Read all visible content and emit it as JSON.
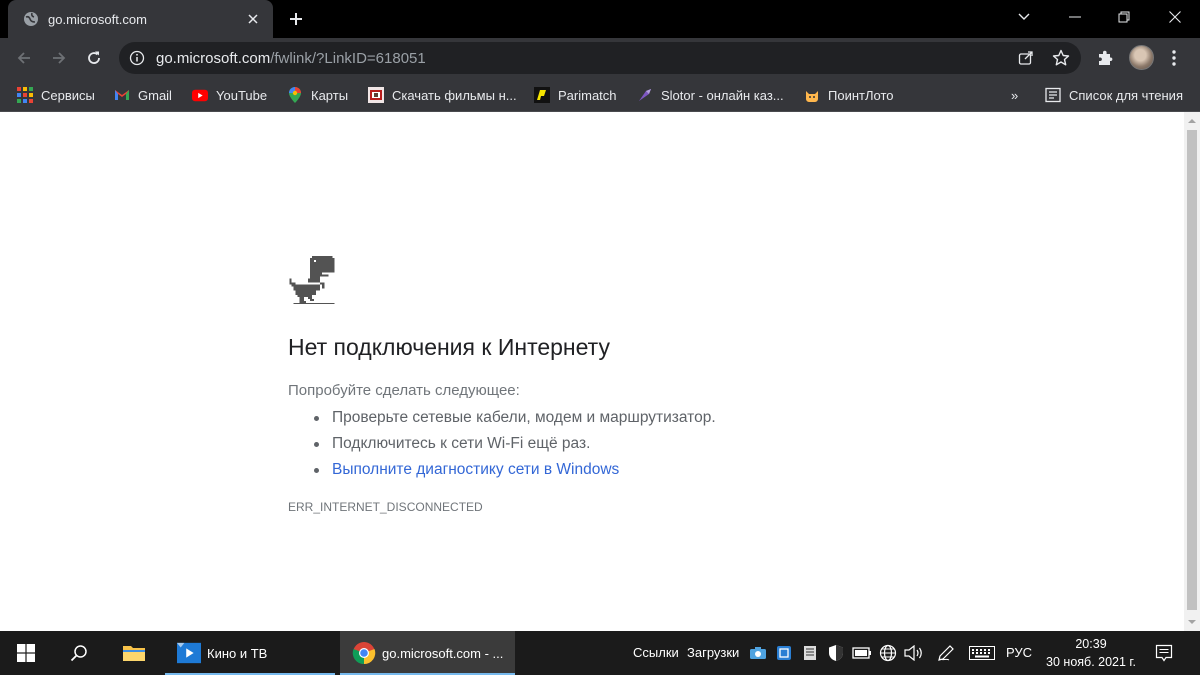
{
  "browser": {
    "tab": {
      "title": "go.microsoft.com"
    },
    "address": {
      "host": "go.microsoft.com",
      "path": "/fwlink/?LinkID=618051"
    },
    "bookmarks": [
      {
        "label": "Сервисы",
        "icon": "apps-grid-icon"
      },
      {
        "label": "Gmail",
        "icon": "gmail-icon"
      },
      {
        "label": "YouTube",
        "icon": "youtube-icon"
      },
      {
        "label": "Карты",
        "icon": "maps-pin-icon"
      },
      {
        "label": "Скачать фильмы н...",
        "icon": "site-favicon"
      },
      {
        "label": "Parimatch",
        "icon": "parimatch-icon"
      },
      {
        "label": "Slotor - онлайн каз...",
        "icon": "slotor-icon"
      },
      {
        "label": "ПоинтЛото",
        "icon": "cat-icon"
      }
    ],
    "overflow_label": "»",
    "reading_list_label": "Список для чтения"
  },
  "page": {
    "title": "Нет подключения к Интернету",
    "try_label": "Попробуйте сделать следующее:",
    "suggestions": [
      "Проверьте сетевые кабели, модем и маршрутизатор.",
      "Подключитесь к сети Wi-Fi ещё раз."
    ],
    "diagnose_link": "Выполните диагностику сети в Windows",
    "error_code": "ERR_INTERNET_DISCONNECTED"
  },
  "taskbar": {
    "tasks": [
      {
        "label": "Кино и ТВ"
      },
      {
        "label": "go.microsoft.com - ..."
      }
    ],
    "toolbars": {
      "links": "Ссылки",
      "downloads": "Загрузки"
    },
    "language": "РУС",
    "time": "20:39",
    "date": "30 нояб. 2021 г."
  },
  "colors": {
    "link": "#3367d6",
    "chrome_dark": "#35363a",
    "taskbar": "#1b1b1b"
  }
}
